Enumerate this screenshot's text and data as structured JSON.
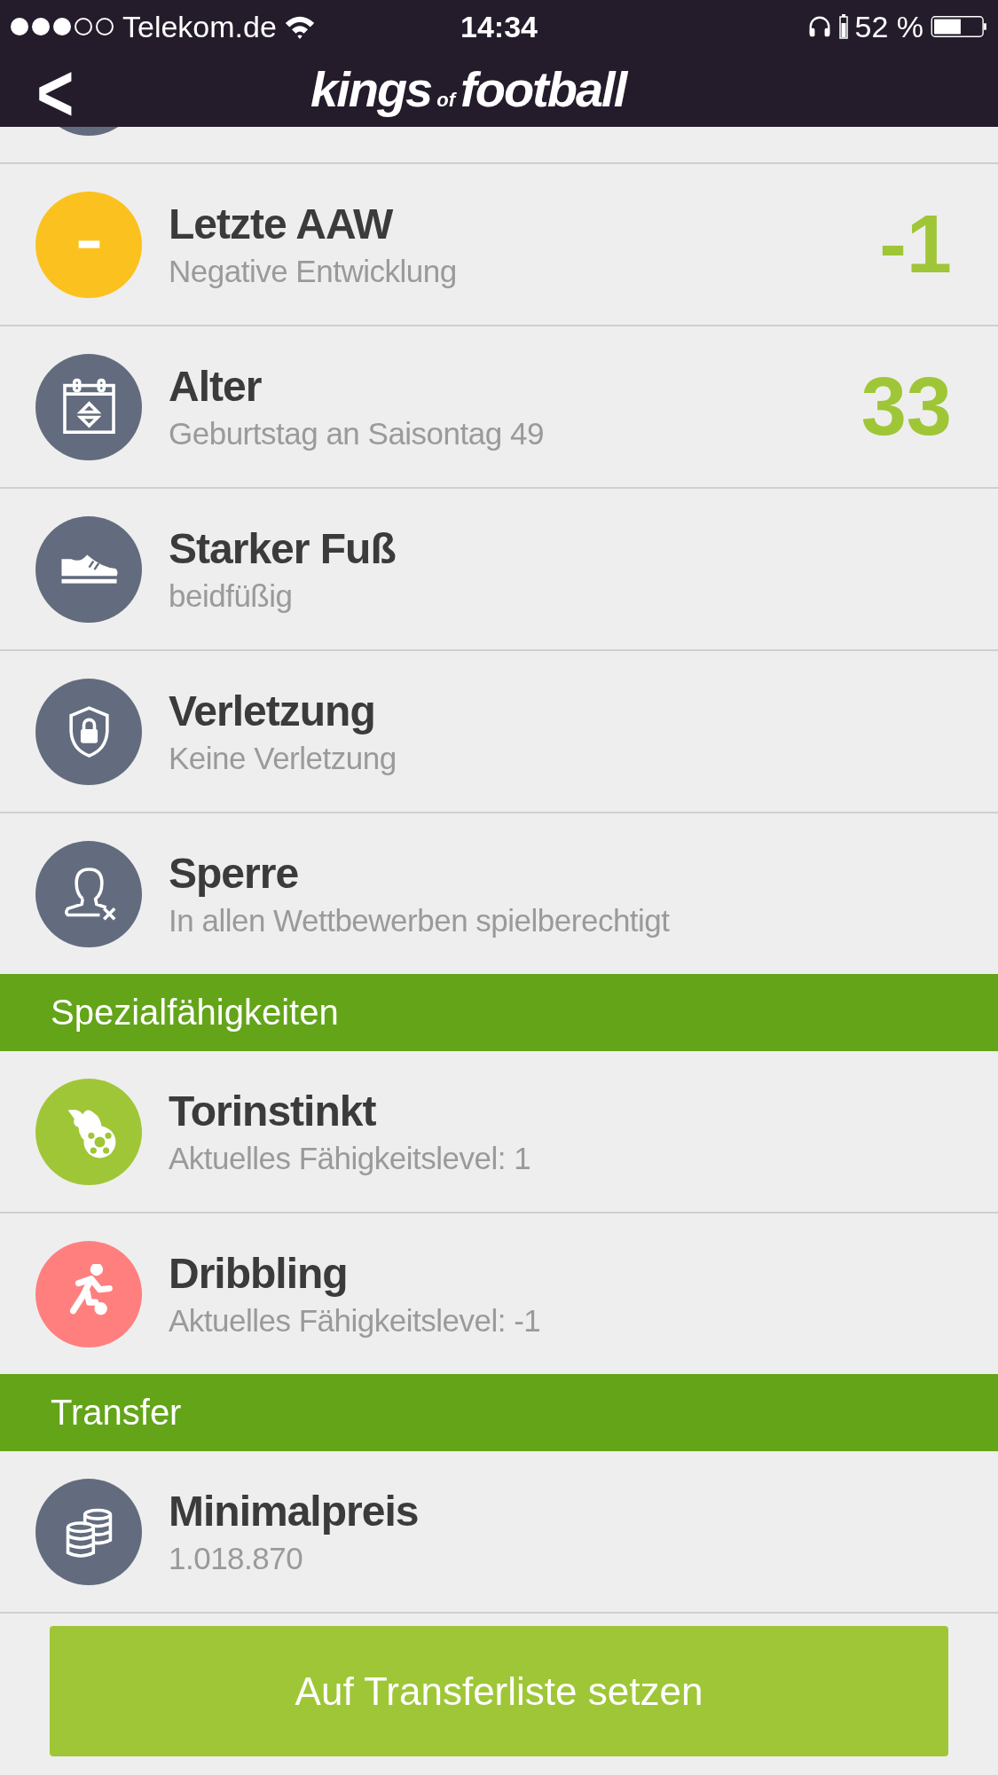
{
  "status_bar": {
    "carrier": "Telekom.de",
    "time": "14:34",
    "battery": "52 %"
  },
  "nav": {
    "back": "<",
    "logo": {
      "first": "kings",
      "middle": "of",
      "last": "football"
    }
  },
  "sections": [
    {
      "rows": [
        {
          "kind": "minus",
          "color": "#fbc21f",
          "title": "Letzte AAW",
          "subtitle": "Negative Entwicklung",
          "value": "-1"
        },
        {
          "kind": "calendar",
          "color": "#636c7e",
          "title": "Alter",
          "subtitle": "Geburtstag an Saisontag 49",
          "value": "33"
        },
        {
          "kind": "shoe",
          "color": "#636c7e",
          "title": "Starker Fuß",
          "subtitle": "beidfüßig"
        },
        {
          "kind": "shield",
          "color": "#636c7e",
          "title": "Verletzung",
          "subtitle": "Keine Verletzung"
        },
        {
          "kind": "person-x",
          "color": "#636c7e",
          "title": "Sperre",
          "subtitle": "In allen Wettbewerben spielberechtigt"
        }
      ]
    },
    {
      "title": "Spezialfähigkeiten",
      "rows": [
        {
          "kind": "fireball",
          "color": "#9fc636",
          "title": "Torinstinkt",
          "subtitle": "Aktuelles Fähigkeitslevel: 1"
        },
        {
          "kind": "player",
          "color": "#ff7f7f",
          "title": "Dribbling",
          "subtitle": "Aktuelles Fähigkeitslevel: -1"
        }
      ]
    },
    {
      "title": "Transfer",
      "rows": [
        {
          "kind": "coins",
          "color": "#636c7e",
          "title": "Minimalpreis",
          "subtitle": "1.018.870"
        }
      ]
    }
  ],
  "action_button": "Auf Transferliste setzen"
}
